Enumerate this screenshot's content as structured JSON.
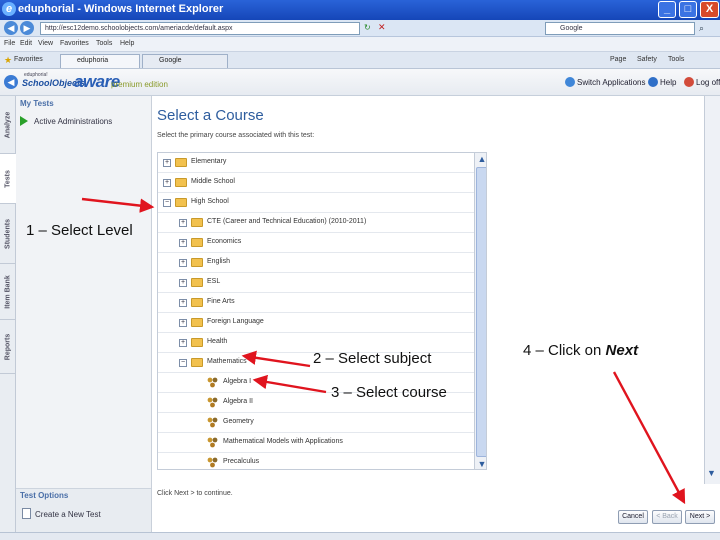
{
  "window": {
    "title": "eduphorial - Windows Internet Explorer",
    "buttons": {
      "minimize": "_",
      "maximize": "□",
      "close": "X"
    }
  },
  "browser": {
    "url": "http://esc12demo.schoolobjects.com/ameriacde/default.aspx",
    "search_placeholder": "Google",
    "menu": [
      "File",
      "Edit",
      "View",
      "Favorites",
      "Tools",
      "Help"
    ],
    "toolbar_right": [
      "Page",
      "Safety",
      "Tools"
    ],
    "favorites_label": "Favorites",
    "tabs": [
      "eduphoria",
      "Google"
    ]
  },
  "app": {
    "brand_small": "eduphoria!",
    "brand_school": "SchoolObjects",
    "brand_aware": "aware",
    "brand_edition": "premium edition",
    "header_links": [
      "Switch Applications",
      "Help",
      "Log off"
    ]
  },
  "left_tabs": [
    "Analyze",
    "Tests",
    "Students",
    "Item Bank",
    "Reports"
  ],
  "sidebar": {
    "my_tests_heading": "My Tests",
    "active_link": "Active Administrations",
    "test_options_heading": "Test Options",
    "create_link": "Create a New Test"
  },
  "main": {
    "title": "Select a Course",
    "instruction": "Select the primary course associated with this test:",
    "tree": [
      {
        "label": "Elementary",
        "level": 0,
        "toggle": "+",
        "kind": "folder"
      },
      {
        "label": "Middle School",
        "level": 0,
        "toggle": "+",
        "kind": "folder"
      },
      {
        "label": "High School",
        "level": 0,
        "toggle": "−",
        "kind": "folder"
      },
      {
        "label": "CTE (Career and Technical Education) (2010-2011)",
        "level": 1,
        "toggle": "+",
        "kind": "folder"
      },
      {
        "label": "Economics",
        "level": 1,
        "toggle": "+",
        "kind": "folder"
      },
      {
        "label": "English",
        "level": 1,
        "toggle": "+",
        "kind": "folder"
      },
      {
        "label": "ESL",
        "level": 1,
        "toggle": "+",
        "kind": "folder"
      },
      {
        "label": "Fine Arts",
        "level": 1,
        "toggle": "+",
        "kind": "folder"
      },
      {
        "label": "Foreign Language",
        "level": 1,
        "toggle": "+",
        "kind": "folder"
      },
      {
        "label": "Health",
        "level": 1,
        "toggle": "+",
        "kind": "folder"
      },
      {
        "label": "Mathematics",
        "level": 1,
        "toggle": "−",
        "kind": "folder"
      },
      {
        "label": "Algebra I",
        "level": 2,
        "toggle": "",
        "kind": "course"
      },
      {
        "label": "Algebra II",
        "level": 2,
        "toggle": "",
        "kind": "course"
      },
      {
        "label": "Geometry",
        "level": 2,
        "toggle": "",
        "kind": "course"
      },
      {
        "label": "Mathematical Models with Applications",
        "level": 2,
        "toggle": "",
        "kind": "course"
      },
      {
        "label": "Precalculus",
        "level": 2,
        "toggle": "",
        "kind": "course"
      }
    ],
    "continue_text": "Click Next > to continue.",
    "buttons": {
      "cancel": "Cancel",
      "back": "< Back",
      "next": "Next >"
    }
  },
  "annotations": {
    "step1": "1 – Select Level",
    "step2": "2 – Select subject",
    "step3": "3 – Select course",
    "step4_prefix": "4 – Click on ",
    "step4_emphasis": "Next",
    "arrow_color": "#e0141e"
  }
}
